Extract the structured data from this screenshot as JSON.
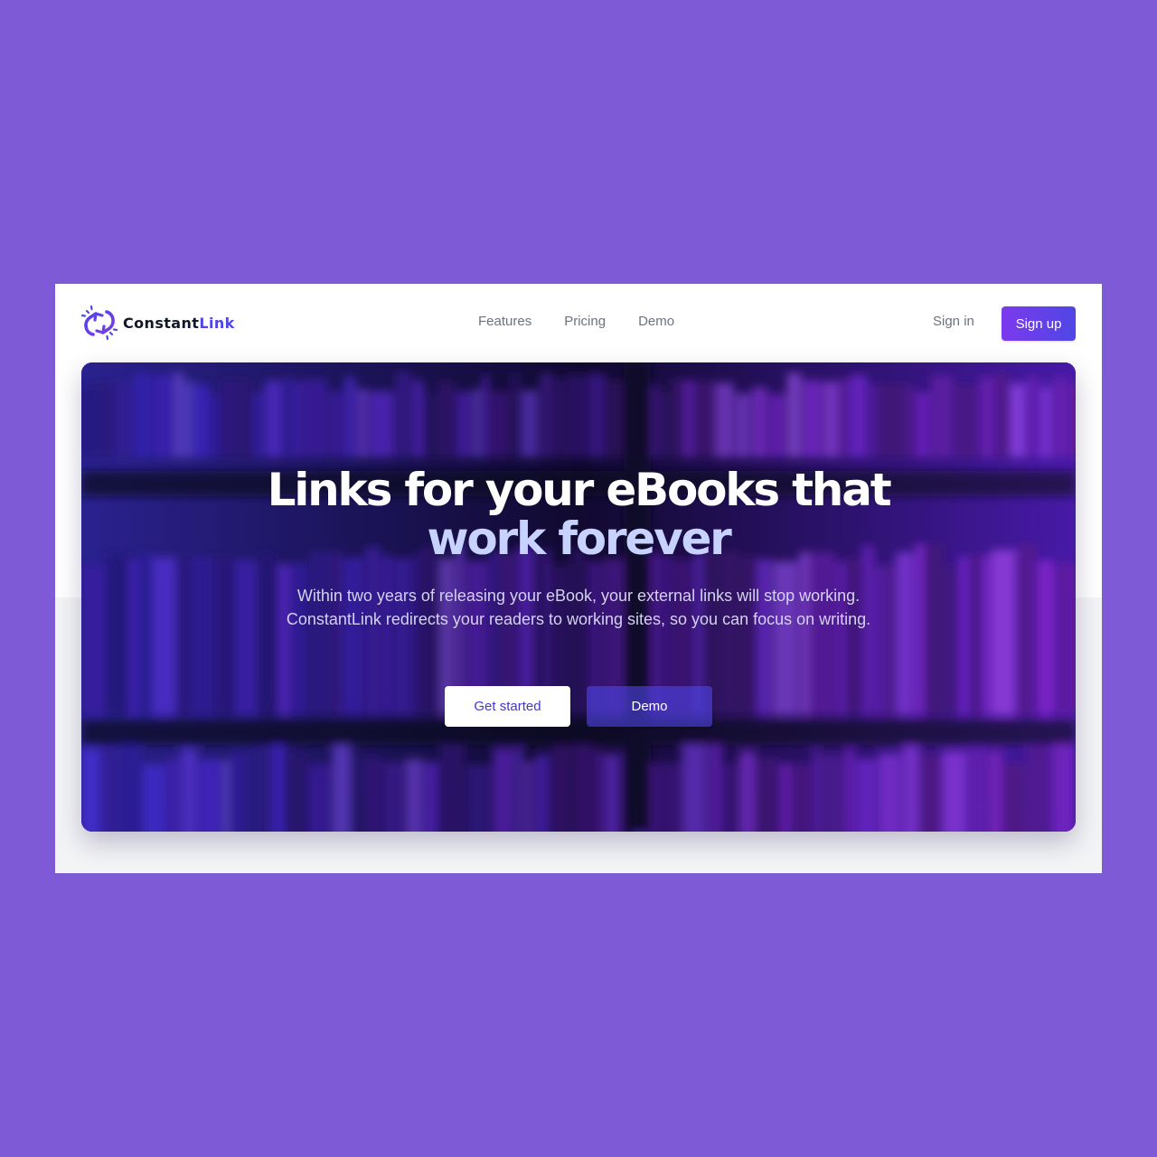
{
  "brand": {
    "name_main": "Constant",
    "name_accent": "Link",
    "accent_color": "#4f46e5"
  },
  "nav": {
    "items": [
      "Features",
      "Pricing",
      "Demo"
    ]
  },
  "auth": {
    "sign_in": "Sign in",
    "sign_up": "Sign up"
  },
  "hero": {
    "title_line1": "Links for your eBooks that",
    "title_line2": "work forever",
    "subtitle": "Within two years of releasing your eBook, your external links will stop working. ConstantLink redirects your readers to working sites, so you can focus on writing.",
    "cta_primary": "Get started",
    "cta_secondary": "Demo"
  },
  "colors": {
    "page_background": "#7f5ad6",
    "hero_title_accent": "#c7d2fe",
    "button_primary_text": "#4338ca"
  },
  "icons": {
    "logo": "link-refresh-icon"
  }
}
